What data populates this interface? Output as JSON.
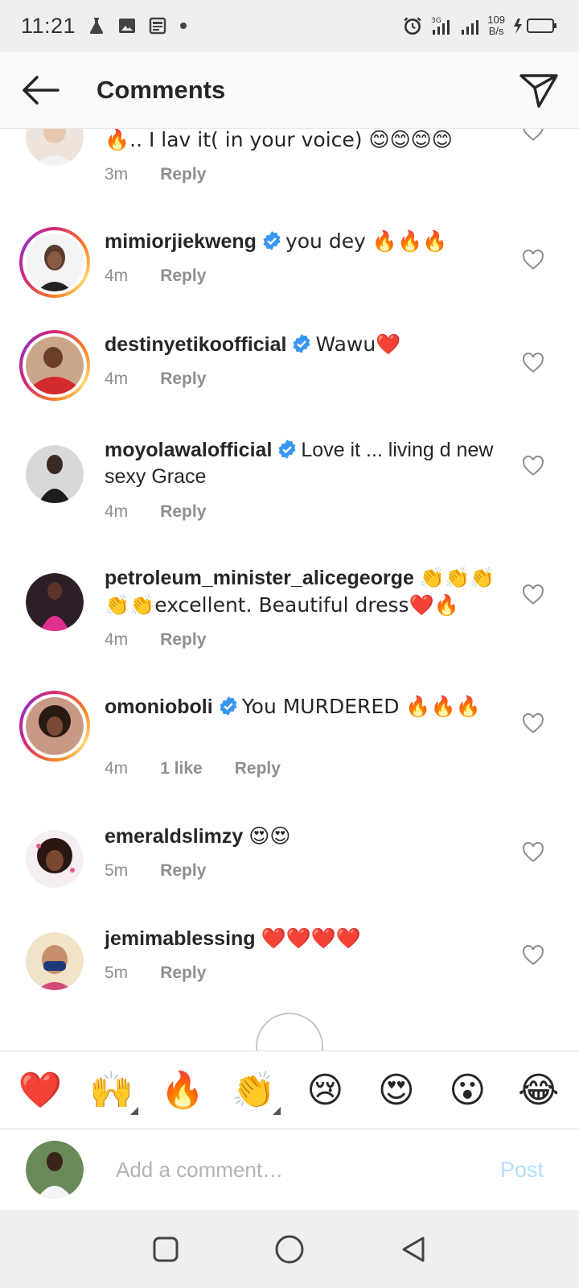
{
  "status_bar": {
    "time": "11:21",
    "net_speed_value": "109",
    "net_speed_unit": "B/s"
  },
  "header": {
    "title": "Comments"
  },
  "comments": [
    {
      "username": "",
      "verified": false,
      "text": "🔥.. I lav it( in your voice) 😊😊😊😊",
      "time": "3m",
      "likes": "",
      "reply": "Reply"
    },
    {
      "username": "mimiorjiekweng",
      "verified": true,
      "text": "you dey 🔥🔥🔥",
      "time": "4m",
      "likes": "",
      "reply": "Reply"
    },
    {
      "username": "destinyetikoofficial",
      "verified": true,
      "text": "Wawu❤️",
      "time": "4m",
      "likes": "",
      "reply": "Reply"
    },
    {
      "username": "moyolawalofficial",
      "verified": true,
      "text": "Love it ... living d new sexy Grace",
      "time": "4m",
      "likes": "",
      "reply": "Reply"
    },
    {
      "username": "petroleum_minister_alicegeorge",
      "verified": false,
      "text": "👏👏👏👏👏excellent.  Beautiful dress❤️🔥",
      "time": "4m",
      "likes": "",
      "reply": "Reply"
    },
    {
      "username": "omonioboli",
      "verified": true,
      "text": "You MURDERED 🔥🔥🔥",
      "time": "4m",
      "likes": "1 like",
      "reply": "Reply"
    },
    {
      "username": "emeraldslimzy",
      "verified": false,
      "text": "😍😍",
      "time": "5m",
      "likes": "",
      "reply": "Reply"
    },
    {
      "username": "jemimablessing",
      "verified": false,
      "text": "❤️❤️❤️❤️",
      "time": "5m",
      "likes": "",
      "reply": "Reply"
    }
  ],
  "reactions": [
    "❤️",
    "🙌",
    "🔥",
    "👏",
    "😢",
    "😍",
    "😮",
    "😂"
  ],
  "composer": {
    "placeholder": "Add a comment…",
    "post_label": "Post"
  },
  "colors": {
    "verified": "#3897f0",
    "post_disabled": "#b2dffc",
    "meta": "#8e8e8e"
  }
}
